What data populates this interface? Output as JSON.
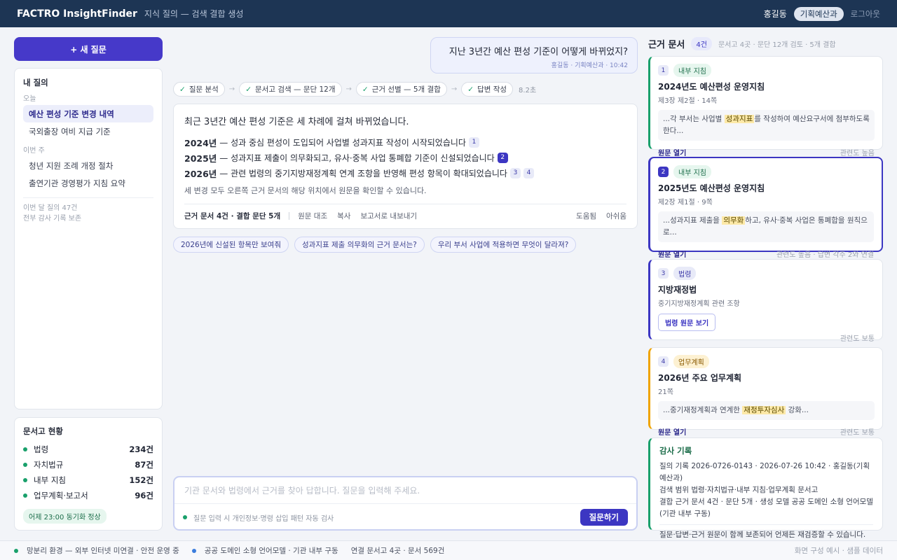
{
  "header": {
    "brand": "FACTRO InsightFinder",
    "subtitle": "지식 질의 — 검색 결합 생성",
    "user": "홍길동",
    "dept": "기획예산과",
    "logout": "로그아웃"
  },
  "sidebar": {
    "new_question": "+ 새 질문",
    "my_questions_title": "내 질의",
    "groups": [
      {
        "label": "오늘",
        "items": [
          "예산 편성 기준 변경 내역",
          "국외출장 여비 지급 기준"
        ]
      },
      {
        "label": "이번 주",
        "items": [
          "청년 지원 조례 개정 절차",
          "출연기관 경영평가 지침 요약"
        ]
      }
    ],
    "month_count": "이번 달 질의 47건",
    "audit_note": "전부 감사 기록 보존",
    "library": {
      "title": "문서고 현황",
      "items": [
        {
          "label": "법령",
          "value": "234건"
        },
        {
          "label": "자치법규",
          "value": "87건"
        },
        {
          "label": "내부 지침",
          "value": "152건"
        },
        {
          "label": "업무계획·보고서",
          "value": "96건"
        }
      ],
      "sync": "어제 23:00 동기화 정상"
    }
  },
  "question": {
    "text": "지난 3년간 예산 편성 기준이 어떻게 바뀌었지?",
    "meta": "홍길동 · 기획예산과 · 10:42"
  },
  "steps": [
    "질문 분석",
    "문서고 검색 — 문단 12개",
    "근거 선별 — 5개 결합",
    "답변 작성"
  ],
  "elapsed": "8.2초",
  "answer": {
    "lead": "최근 3년간 예산 편성 기준은 세 차례에 걸쳐 바뀌었습니다.",
    "lines": [
      {
        "year": "2024년",
        "text": "— 성과 중심 편성이 도입되어 사업별 성과지표 작성이 시작되었습니다",
        "cites": [
          "1"
        ]
      },
      {
        "year": "2025년",
        "text": "— 성과지표 제출이 의무화되고, 유사·중복 사업 통폐합 기준이 신설되었습니다",
        "cites": [
          "2"
        ]
      },
      {
        "year": "2026년",
        "text": "— 관련 법령의 중기지방재정계획 연계 조항을 반영해 편성 항목이 확대되었습니다",
        "cites": [
          "3",
          "4"
        ]
      }
    ],
    "note": "세 변경 모두 오른쪽 근거 문서의 해당 위치에서 원문을 확인할 수 있습니다.",
    "summary": "근거 문서 4건 · 결합 문단 5개",
    "actions": [
      "원문 대조",
      "복사",
      "보고서로 내보내기"
    ],
    "feedback": [
      "도움됨",
      "아쉬움"
    ]
  },
  "suggestions": [
    "2026년에 신설된 항목만 보여줘",
    "성과지표 제출 의무화의 근거 문서는?",
    "우리 부서 사업에 적용하면 무엇이 달라져?"
  ],
  "input": {
    "placeholder": "기관 문서와 법령에서 근거를 찾아 답합니다. 질문을 입력해 주세요.",
    "privacy": "질문 입력 시 개인정보·명령 삽입 패턴 자동 검사",
    "submit": "질문하기"
  },
  "evidence": {
    "title": "근거 문서",
    "count": "4건",
    "summary": "문서고 4곳 · 문단 12개 검토 · 5개 결합",
    "cards": [
      {
        "num": "1",
        "tag": "내부 지침",
        "title": "2024년도 예산편성 운영지침",
        "loc": "제3장 제2절 · 14쪽",
        "snip_pre": "...각 부서는 사업별 ",
        "snip_hl": "성과지표",
        "snip_post": "를 작성하여 예산요구서에 첨부하도록 한다...",
        "open": "원문 열기",
        "rel": "관련도 높음"
      },
      {
        "num": "2",
        "tag": "내부 지침",
        "title": "2025년도 예산편성 운영지침",
        "loc": "제2장 제1절 · 9쪽",
        "snip_pre": "...성과지표 제출을 ",
        "snip_hl": "의무화",
        "snip_post": "하고, 유사·중복 사업은 통폐합을 원칙으로...",
        "open": "원문 열기",
        "rel": "관련도 높음 · 답변 각주 2와 연결"
      },
      {
        "num": "3",
        "tag": "법령",
        "title": "지방재정법",
        "loc": "중기지방재정계획 관련 조항",
        "button": "법령 원문 보기",
        "rel": "관련도 보통"
      },
      {
        "num": "4",
        "tag": "업무계획",
        "title": "2026년 주요 업무계획",
        "loc": "21쪽",
        "snip_pre": "...중기재정계획과 연계한 ",
        "snip_hl": "재정투자심사",
        "snip_post": " 강화...",
        "open": "원문 열기",
        "rel": "관련도 보통"
      }
    ]
  },
  "audit": {
    "title": "감사 기록",
    "lines": [
      "질의 기록 2026-0726-0143 · 2026-07-26 10:42 · 홍길동(기획예산과)",
      "검색 범위 법령·자치법규·내부 지침·업무계획 문서고",
      "결합 근거 문서 4건 · 문단 5개 · 생성 모델 공공 도메인 소형 언어모델 (기관 내부 구동)"
    ],
    "footer": "질문·답변·근거 원문이 함께 보존되어 언제든 재검증할 수 있습니다."
  },
  "statusbar": {
    "items": [
      "망분리 환경 — 외부 인터넷 미연결 · 안전 운영 중",
      "공공 도메인 소형 언어모델 · 기관 내부 구동",
      "연결 문서고 4곳 · 문서 569건"
    ],
    "right": "화면 구성 예시 · 샘플 데이터"
  },
  "colors": {
    "accent": "#3c36c2",
    "header": "#1d3554",
    "green": "#19a06b",
    "blue": "#3b7ddd",
    "amber": "#f0a400"
  }
}
